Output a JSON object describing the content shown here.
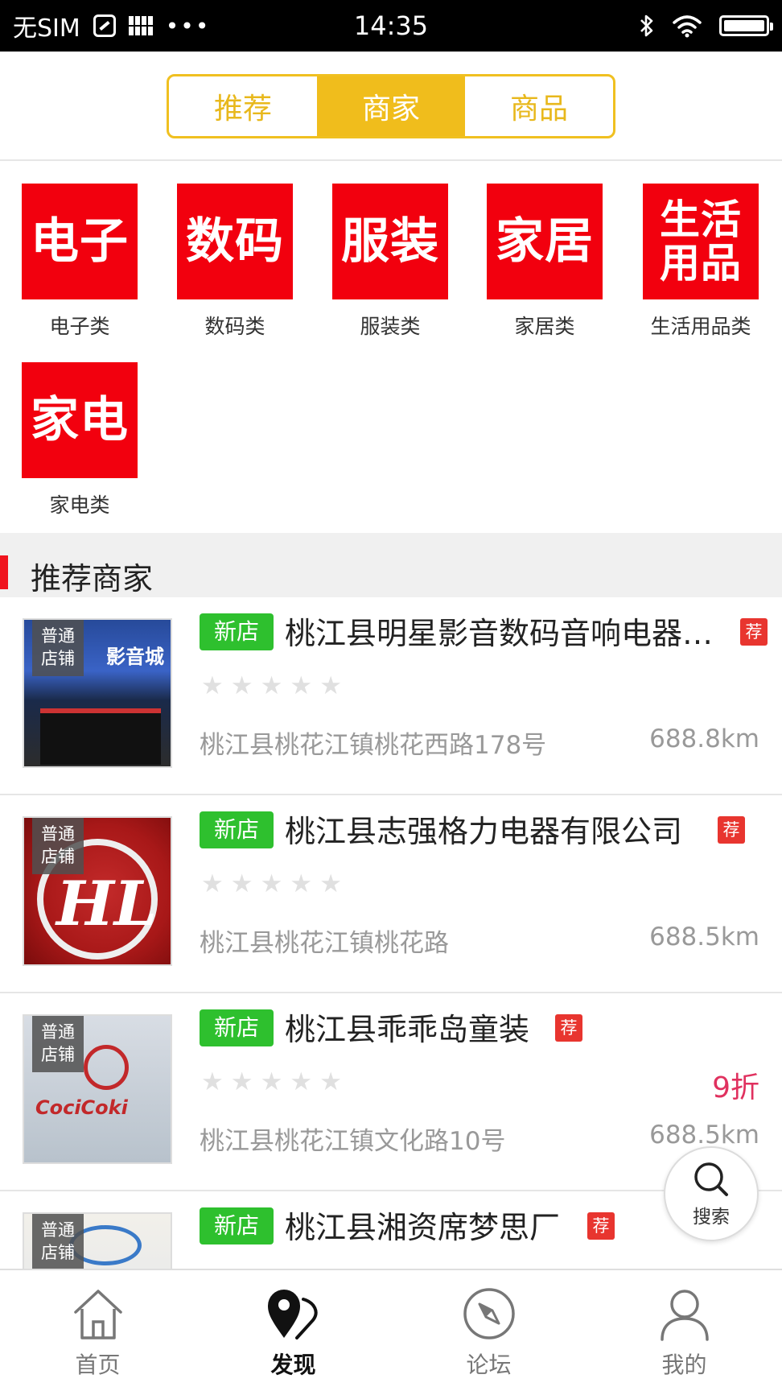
{
  "status_bar": {
    "carrier": "无SIM",
    "dots": "•••",
    "time": "14:35"
  },
  "segments": [
    {
      "label": "推荐",
      "active": false
    },
    {
      "label": "商家",
      "active": true
    },
    {
      "label": "商品",
      "active": false
    }
  ],
  "categories": [
    {
      "tile": "电子",
      "label": "电子类"
    },
    {
      "tile": "数码",
      "label": "数码类"
    },
    {
      "tile": "服装",
      "label": "服装类"
    },
    {
      "tile": "家居",
      "label": "家居类"
    },
    {
      "tile": "生活\n用品",
      "label": "生活用品类"
    },
    {
      "tile": "家电",
      "label": "家电类"
    }
  ],
  "section": {
    "title": "推荐商家"
  },
  "shops": [
    {
      "badge": "普通\n店铺",
      "sign": "影音城",
      "tag": "新店",
      "name": "桃江县明星影音数码音响电器…",
      "rec": "荐",
      "address": "桃江县桃花江镇桃花西路178号",
      "distance": "688.8km",
      "discount": ""
    },
    {
      "badge": "普通\n店铺",
      "logo": "HL",
      "tag": "新店",
      "name": "桃江县志强格力电器有限公司",
      "rec": "荐",
      "address": "桃江县桃花江镇桃花路",
      "distance": "688.5km",
      "discount": ""
    },
    {
      "badge": "普通\n店铺",
      "logo": "CociCoki",
      "tag": "新店",
      "name": "桃江县乖乖岛童装",
      "rec": "荐",
      "address": "桃江县桃花江镇文化路10号",
      "distance": "688.5km",
      "discount": "9折"
    },
    {
      "badge": "普通\n店铺",
      "tag": "新店",
      "name": "桃江县湘资席梦思厂",
      "rec": "荐",
      "address": "",
      "distance": "",
      "discount": ""
    }
  ],
  "fab": {
    "label": "搜索",
    "icon": "search-icon"
  },
  "tabbar": [
    {
      "label": "首页",
      "icon": "home-icon",
      "active": false
    },
    {
      "label": "发现",
      "icon": "location-pin-icon",
      "active": true
    },
    {
      "label": "论坛",
      "icon": "compass-icon",
      "active": false
    },
    {
      "label": "我的",
      "icon": "user-icon",
      "active": false
    }
  ],
  "colors": {
    "accent_yellow": "#f0bd1c",
    "category_red": "#f2000e",
    "new_green": "#2ec02e",
    "rec_red": "#e8352f",
    "discount_pink": "#e0315f"
  }
}
